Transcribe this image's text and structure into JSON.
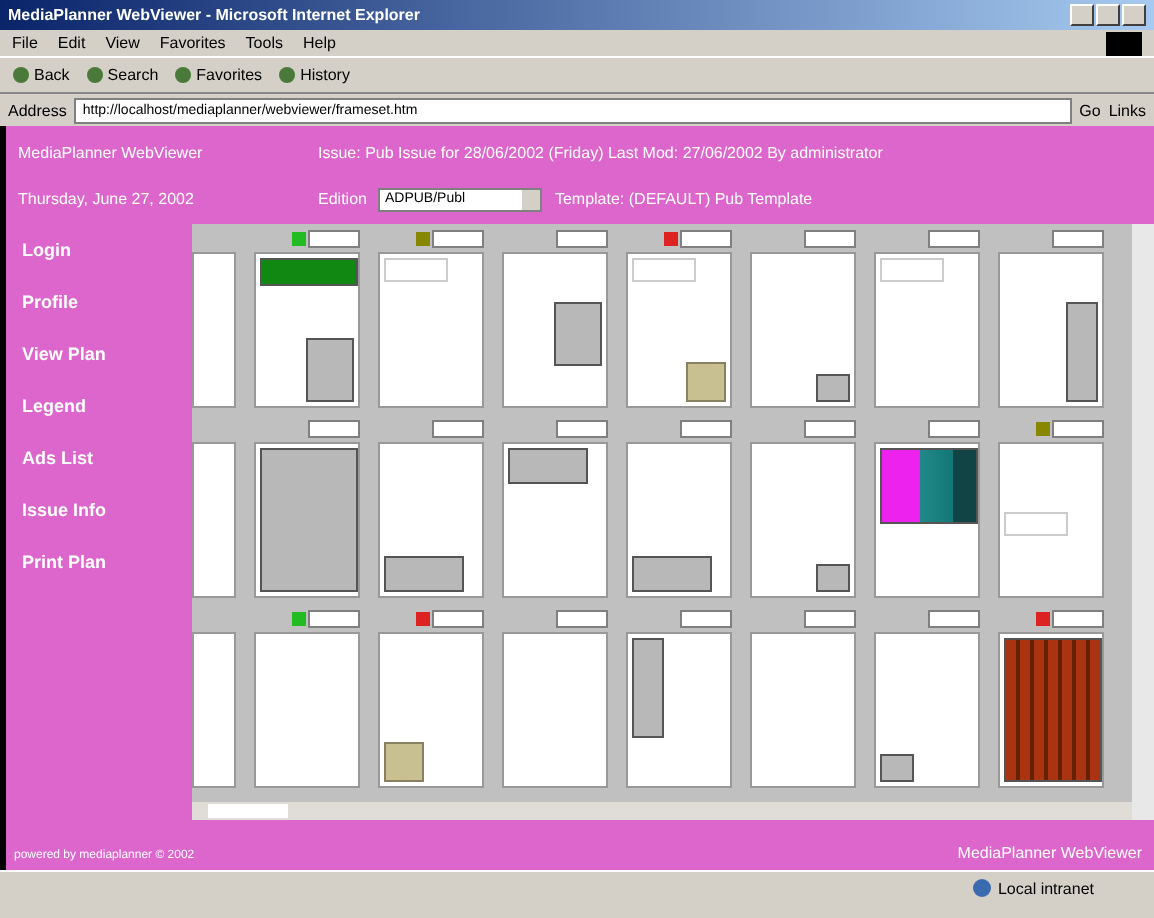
{
  "window": {
    "title": "MediaPlanner WebViewer - Microsoft Internet Explorer"
  },
  "menu": [
    "File",
    "Edit",
    "View",
    "Favorites",
    "Tools",
    "Help"
  ],
  "toolbar": [
    "Back",
    "Search",
    "Favorites",
    "History"
  ],
  "address": {
    "label": "Address",
    "value": "http://localhost/mediaplanner/webviewer/frameset.htm",
    "go": "Go",
    "links": "Links"
  },
  "header": {
    "app_name": "MediaPlanner WebViewer",
    "date": "Thursday, June 27, 2002",
    "issue": "Issue: Pub Issue for 28/06/2002 (Friday)   Last Mod: 27/06/2002 By administrator",
    "edition_label": "Edition",
    "edition_value": "ADPUB/Publ",
    "template": "Template: (DEFAULT) Pub Template"
  },
  "sidebar": {
    "items": [
      {
        "label": "Login"
      },
      {
        "label": "Profile"
      },
      {
        "label": "View Plan"
      },
      {
        "label": "Legend"
      },
      {
        "label": "Ads List"
      },
      {
        "label": "Issue Info"
      },
      {
        "label": "Print Plan"
      }
    ]
  },
  "plan": {
    "rows": [
      [
        {
          "kind": "partial"
        },
        {
          "kind": "page",
          "color": "#22bb22",
          "ads": [
            {
              "kind": "banner"
            },
            {
              "kind": "corner"
            }
          ]
        },
        {
          "kind": "page",
          "color": "#888800",
          "ads": [
            {
              "kind": "copy"
            }
          ]
        },
        {
          "kind": "page",
          "ads": [
            {
              "kind": "side"
            }
          ]
        },
        {
          "kind": "page",
          "color": "#dd2222",
          "ads": [
            {
              "kind": "copy"
            },
            {
              "kind": "tan"
            }
          ]
        },
        {
          "kind": "page",
          "ads": [
            {
              "kind": "small"
            }
          ]
        },
        {
          "kind": "page",
          "ads": [
            {
              "kind": "copy"
            }
          ]
        },
        {
          "kind": "page",
          "ads": [
            {
              "kind": "tall"
            }
          ]
        }
      ],
      [
        {
          "kind": "partial"
        },
        {
          "kind": "page",
          "ads": [
            {
              "kind": "full"
            }
          ]
        },
        {
          "kind": "page",
          "ads": [
            {
              "kind": "strip"
            }
          ]
        },
        {
          "kind": "page",
          "ads": [
            {
              "kind": "header"
            }
          ]
        },
        {
          "kind": "page",
          "ads": [
            {
              "kind": "strip"
            }
          ]
        },
        {
          "kind": "page",
          "ads": [
            {
              "kind": "small"
            }
          ]
        },
        {
          "kind": "page",
          "ads": [
            {
              "kind": "mosaic"
            }
          ]
        },
        {
          "kind": "page",
          "color": "#888800",
          "ads": [
            {
              "kind": "caption"
            }
          ]
        }
      ],
      [
        {
          "kind": "partial"
        },
        {
          "kind": "page",
          "color": "#22bb22"
        },
        {
          "kind": "page",
          "color": "#dd2222",
          "ads": [
            {
              "kind": "tanleft"
            }
          ]
        },
        {
          "kind": "page"
        },
        {
          "kind": "page",
          "ads": [
            {
              "kind": "column"
            }
          ]
        },
        {
          "kind": "page"
        },
        {
          "kind": "page",
          "ads": [
            {
              "kind": "smallleft"
            }
          ]
        },
        {
          "kind": "page",
          "color": "#dd2222",
          "ads": [
            {
              "kind": "brick"
            }
          ]
        }
      ]
    ]
  },
  "footer": {
    "powered_by": "powered by mediaplanner © 2002",
    "app_name": "MediaPlanner WebViewer"
  },
  "status_bar": {
    "zone": "Local intranet"
  }
}
